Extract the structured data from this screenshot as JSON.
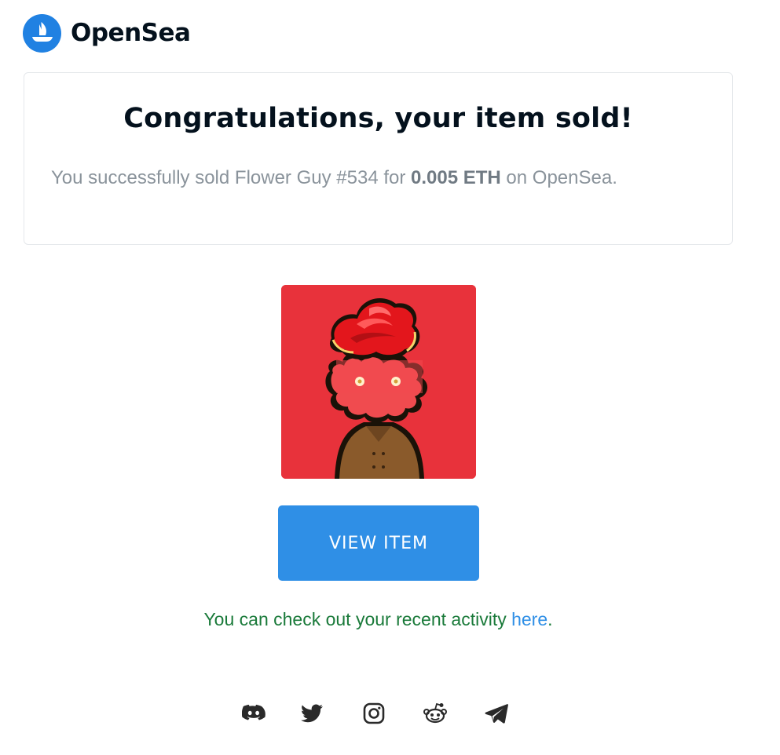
{
  "header": {
    "brand_name": "OpenSea",
    "logo_icon": "opensea-sailboat-icon",
    "brand_color": "#2081e2"
  },
  "card": {
    "title": "Congratulations, your item sold!",
    "message_prefix": "You successfully sold Flower Guy #534 for ",
    "price": "0.005 ETH",
    "message_suffix": " on OpenSea."
  },
  "nft": {
    "image_icon": "flower-guy-nft-image",
    "background_color": "#e8323b"
  },
  "cta": {
    "label": "VIEW ITEM",
    "color": "#2f8fe6"
  },
  "activity": {
    "prefix": "You can check out your recent activity ",
    "link_text": "here",
    "suffix": "."
  },
  "footer": {
    "social_icons": [
      "discord-icon",
      "twitter-icon",
      "instagram-icon",
      "reddit-icon",
      "telegram-icon"
    ]
  }
}
